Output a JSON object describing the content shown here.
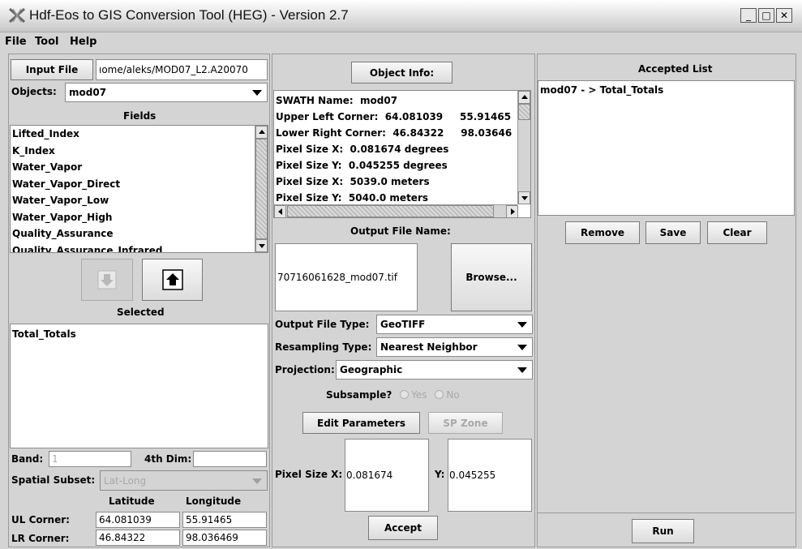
{
  "window": {
    "title": "Hdf-Eos to GIS Conversion Tool (HEG) - Version 2.7",
    "minimize_glyph": "_",
    "maximize_glyph": "□",
    "close_glyph": "✕"
  },
  "menu": [
    "File",
    "Tool",
    "Help"
  ],
  "left": {
    "input_file_button": "Input File",
    "input_file_path": "ıome/aleks/MOD07_L2.A20070",
    "objects_label": "Objects:",
    "objects_value": "mod07",
    "fields_header": "Fields",
    "fields": [
      "Lifted_Index",
      "K_Index",
      "Water_Vapor",
      "Water_Vapor_Direct",
      "Water_Vapor_Low",
      "Water_Vapor_High",
      "Quality_Assurance",
      "Quality_Assurance_Infrared"
    ],
    "selected_header": "Selected",
    "selected": [
      "Total_Totals"
    ],
    "band_label": "Band:",
    "band_value": "1",
    "fourth_dim_label": "4th Dim:",
    "fourth_dim_value": "",
    "spatial_subset_label": "Spatial Subset:",
    "spatial_subset_value": "Lat-Long",
    "latitude_header": "Latitude",
    "longitude_header": "Longitude",
    "ul_corner_label": "UL Corner:",
    "ul_lat": "64.081039",
    "ul_lon": "55.91465",
    "lr_corner_label": "LR Corner:",
    "lr_lat": "46.84322",
    "lr_lon": "98.036469"
  },
  "middle": {
    "object_info_button": "Object Info:",
    "info_lines": [
      "SWATH Name:  mod07",
      "Upper Left Corner:  64.081039     55.91465",
      "Lower Right Corner:  46.84322     98.03646",
      "Pixel Size X:  0.081674 degrees",
      "Pixel Size Y:  0.045255 degrees",
      "Pixel Size X:  5039.0 meters",
      "Pixel Size Y:  5040.0 meters"
    ],
    "output_file_name_label": "Output File Name:",
    "output_file_name_value": "70716061628_mod07.tif",
    "browse_button": "Browse...",
    "output_file_type_label": "Output File Type:",
    "output_file_type_value": "GeoTIFF",
    "resampling_type_label": "Resampling Type:",
    "resampling_type_value": "Nearest Neighbor",
    "projection_label": "Projection:",
    "projection_value": "Geographic",
    "subsample_label": "Subsample?",
    "subsample_yes": "Yes",
    "subsample_no": "No",
    "edit_parameters_button": "Edit Parameters",
    "sp_zone_button": "SP Zone",
    "pixel_size_x_label": "Pixel Size X:",
    "pixel_size_x_value": "0.081674",
    "y_label": "Y:",
    "pixel_size_y_value": "0.045255",
    "accept_button": "Accept"
  },
  "right": {
    "accepted_list_header": "Accepted List",
    "accepted": [
      "mod07 - > Total_Totals"
    ],
    "remove_button": "Remove",
    "save_button": "Save",
    "clear_button": "Clear",
    "run_button": "Run"
  }
}
